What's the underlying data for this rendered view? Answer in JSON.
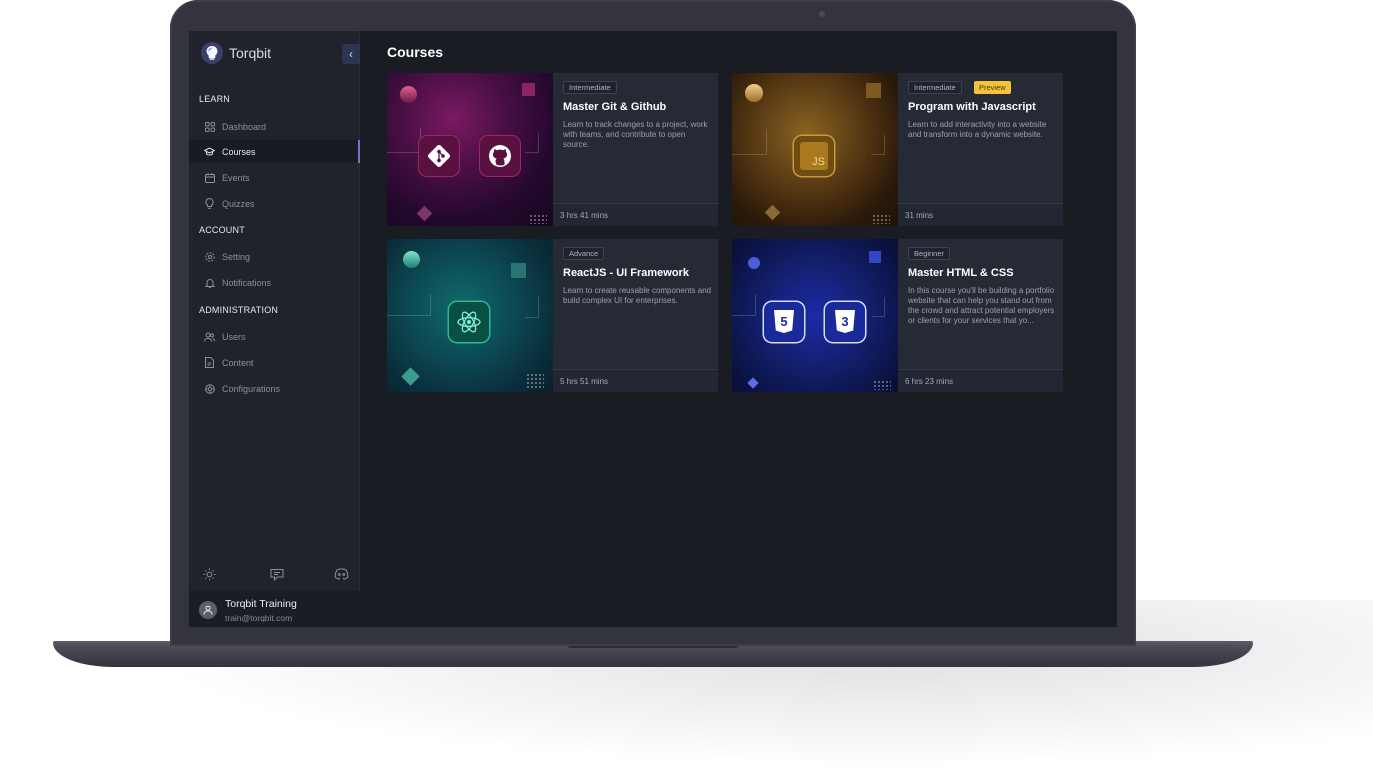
{
  "app": {
    "name": "Torqbit",
    "collapse_icon": "chevron-left-icon"
  },
  "page": {
    "title": "Courses"
  },
  "sidebar": {
    "sections": [
      {
        "label": "LEARN",
        "items": [
          {
            "label": "Dashboard",
            "icon": "grid-icon",
            "active": false
          },
          {
            "label": "Courses",
            "icon": "graduation-cap-icon",
            "active": true
          },
          {
            "label": "Events",
            "icon": "calendar-icon",
            "active": false
          },
          {
            "label": "Quizzes",
            "icon": "bulb-icon",
            "active": false
          }
        ]
      },
      {
        "label": "ACCOUNT",
        "items": [
          {
            "label": "Setting",
            "icon": "gear-icon",
            "active": false
          },
          {
            "label": "Notifications",
            "icon": "bell-icon",
            "active": false
          }
        ]
      },
      {
        "label": "ADMINISTRATION",
        "items": [
          {
            "label": "Users",
            "icon": "users-icon",
            "active": false
          },
          {
            "label": "Content",
            "icon": "document-icon",
            "active": false
          },
          {
            "label": "Configurations",
            "icon": "config-icon",
            "active": false
          }
        ]
      }
    ],
    "tools": [
      "sun-icon",
      "chat-icon",
      "discord-icon"
    ],
    "user": {
      "name": "Torqbit Training",
      "email": "train@torqbit.com"
    }
  },
  "courses": [
    {
      "level": "Intermediate",
      "preview": "",
      "title": "Master Git & Github",
      "description": "Learn to track changes to a project, work with teams, and contribute to open source.",
      "duration": "3 hrs 41 mins",
      "logos": [
        "git-icon",
        "github-icon"
      ],
      "accent": "#c2185b"
    },
    {
      "level": "Intermediate",
      "preview": "Preview",
      "title": "Program with Javascript",
      "description": "Learn to add interactivity into a website and transform into a dynamic website.",
      "duration": "31 mins",
      "logos": [
        "javascript-icon"
      ],
      "accent": "#b8862b"
    },
    {
      "level": "Advance",
      "preview": "",
      "title": "ReactJS - UI Framework",
      "description": "Learn to create reusable components and build complex UI for enterprises.",
      "duration": "5 hrs 51 mins",
      "logos": [
        "react-icon"
      ],
      "accent": "#0f7d7a"
    },
    {
      "level": "Beginner",
      "preview": "",
      "title": "Master HTML & CSS",
      "description": "In this course you'll be building a portfolio website that can help you stand out from the crowd and attract potential employers or clients for your services that yo...",
      "duration": "6 hrs 23 mins",
      "logos": [
        "html5-icon",
        "css3-icon"
      ],
      "accent": "#1e2fb0"
    }
  ],
  "logo_text": {
    "js": "JS",
    "html": "5",
    "css": "3"
  },
  "colors": {
    "sidebar_bg": "#21232c",
    "content_bg": "#1a1c24",
    "card_bg": "#262a35",
    "active_indicator": "#6f78c8",
    "preview_badge": "#f3c33b"
  }
}
